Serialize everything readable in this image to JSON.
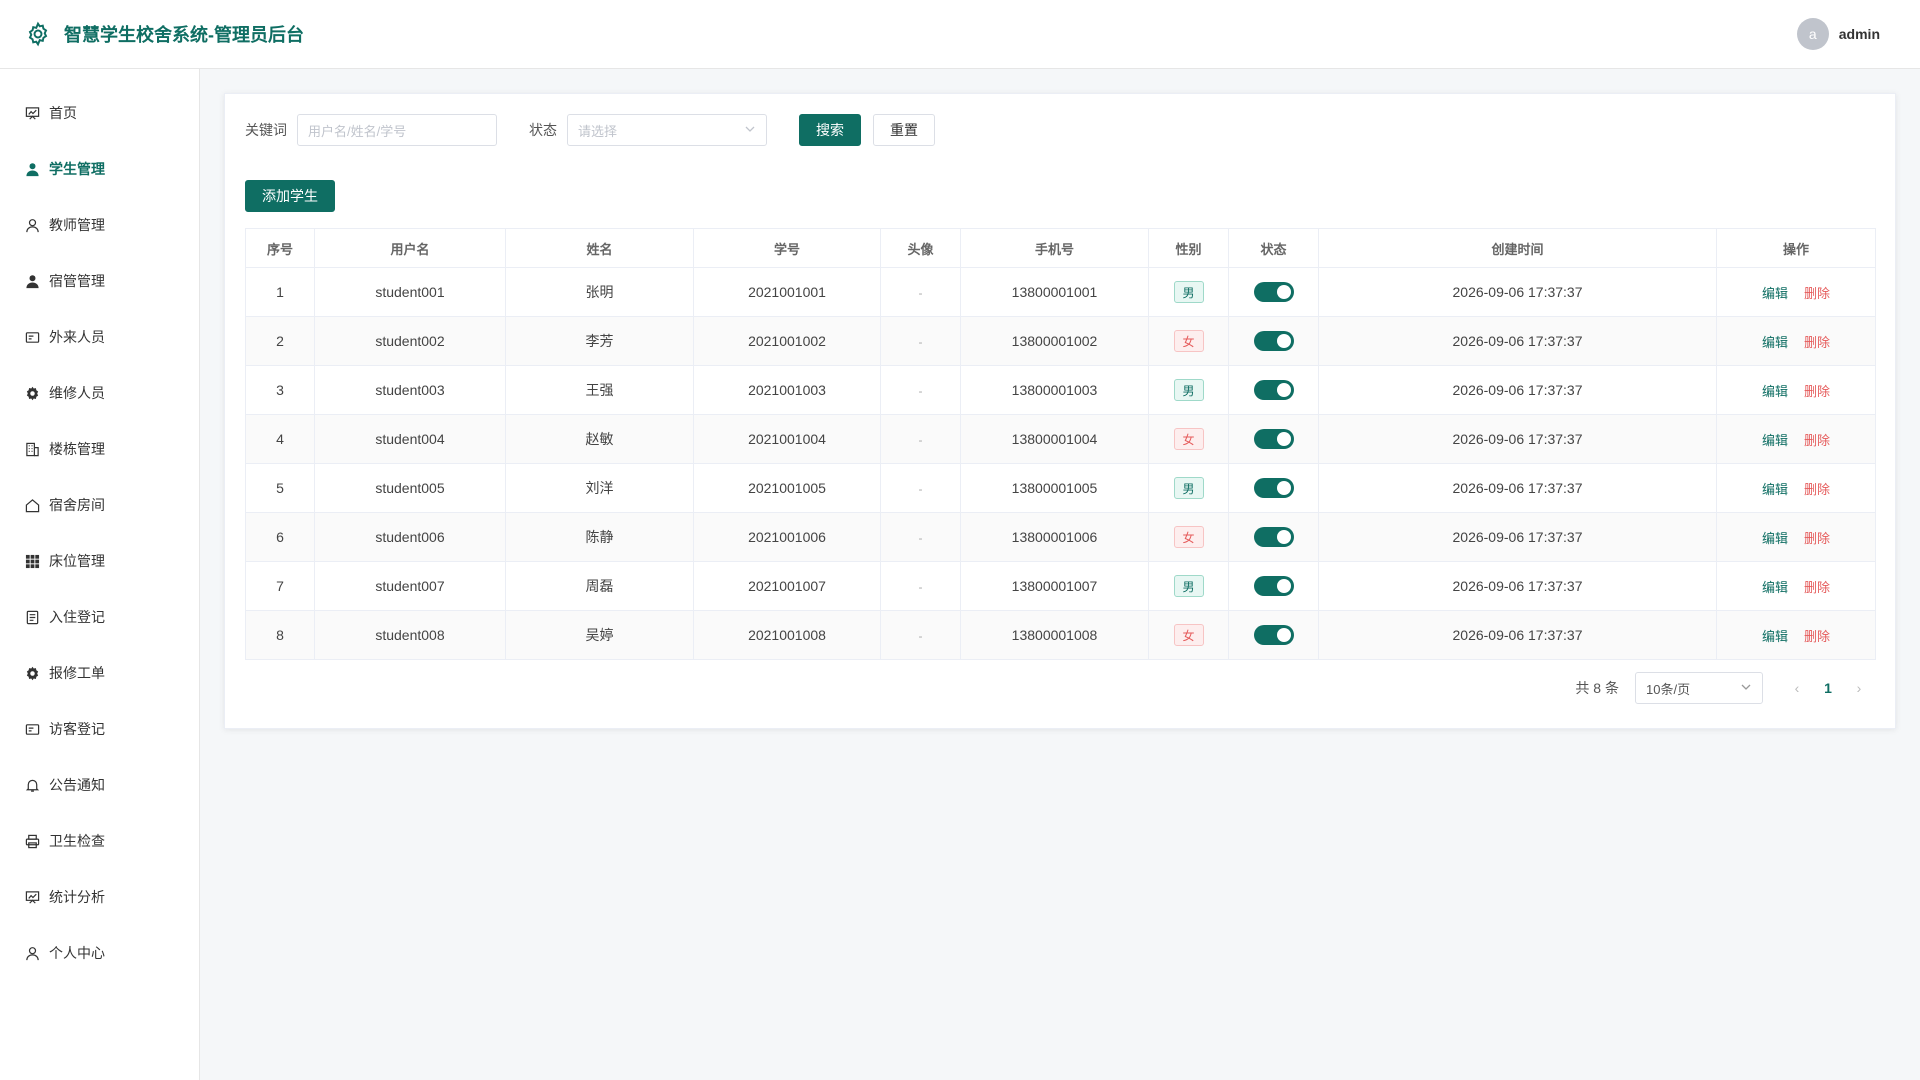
{
  "app": {
    "title": "智慧学生校舍系统-管理员后台"
  },
  "user": {
    "avatar_initial": "a",
    "name": "admin"
  },
  "sidebar": {
    "items": [
      {
        "label": "首页",
        "icon": "chart-board-icon"
      },
      {
        "label": "学生管理",
        "icon": "user-icon",
        "active": true
      },
      {
        "label": "教师管理",
        "icon": "user-outline-icon"
      },
      {
        "label": "宿管管理",
        "icon": "user-icon"
      },
      {
        "label": "外来人员",
        "icon": "id-card-icon"
      },
      {
        "label": "维修人员",
        "icon": "gear-icon"
      },
      {
        "label": "楼栋管理",
        "icon": "building-icon"
      },
      {
        "label": "宿舍房间",
        "icon": "house-icon"
      },
      {
        "label": "床位管理",
        "icon": "grid-icon"
      },
      {
        "label": "入住登记",
        "icon": "document-icon"
      },
      {
        "label": "报修工单",
        "icon": "gear-icon"
      },
      {
        "label": "访客登记",
        "icon": "id-card-icon"
      },
      {
        "label": "公告通知",
        "icon": "bell-icon"
      },
      {
        "label": "卫生检查",
        "icon": "printer-icon"
      },
      {
        "label": "统计分析",
        "icon": "chart-board-icon"
      },
      {
        "label": "个人中心",
        "icon": "user-outline-icon"
      }
    ]
  },
  "filter": {
    "keyword_label": "关键词",
    "keyword_placeholder": "用户名/姓名/学号",
    "status_label": "状态",
    "status_placeholder": "请选择",
    "search_label": "搜索",
    "reset_label": "重置"
  },
  "toolbar": {
    "add_label": "添加学生"
  },
  "table": {
    "headers": [
      "序号",
      "用户名",
      "姓名",
      "学号",
      "头像",
      "手机号",
      "性别",
      "状态",
      "创建时间",
      "操作"
    ],
    "edit_label": "编辑",
    "delete_label": "删除",
    "rows": [
      {
        "no": "1",
        "username": "student001",
        "name": "张明",
        "sid": "2021001001",
        "avatar": "-",
        "phone": "13800001001",
        "gender": "男",
        "enabled": true,
        "created": "2026-09-06 17:37:37"
      },
      {
        "no": "2",
        "username": "student002",
        "name": "李芳",
        "sid": "2021001002",
        "avatar": "-",
        "phone": "13800001002",
        "gender": "女",
        "enabled": true,
        "created": "2026-09-06 17:37:37"
      },
      {
        "no": "3",
        "username": "student003",
        "name": "王强",
        "sid": "2021001003",
        "avatar": "-",
        "phone": "13800001003",
        "gender": "男",
        "enabled": true,
        "created": "2026-09-06 17:37:37"
      },
      {
        "no": "4",
        "username": "student004",
        "name": "赵敏",
        "sid": "2021001004",
        "avatar": "-",
        "phone": "13800001004",
        "gender": "女",
        "enabled": true,
        "created": "2026-09-06 17:37:37"
      },
      {
        "no": "5",
        "username": "student005",
        "name": "刘洋",
        "sid": "2021001005",
        "avatar": "-",
        "phone": "13800001005",
        "gender": "男",
        "enabled": true,
        "created": "2026-09-06 17:37:37"
      },
      {
        "no": "6",
        "username": "student006",
        "name": "陈静",
        "sid": "2021001006",
        "avatar": "-",
        "phone": "13800001006",
        "gender": "女",
        "enabled": true,
        "created": "2026-09-06 17:37:37"
      },
      {
        "no": "7",
        "username": "student007",
        "name": "周磊",
        "sid": "2021001007",
        "avatar": "-",
        "phone": "13800001007",
        "gender": "男",
        "enabled": true,
        "created": "2026-09-06 17:37:37"
      },
      {
        "no": "8",
        "username": "student008",
        "name": "吴婷",
        "sid": "2021001008",
        "avatar": "-",
        "phone": "13800001008",
        "gender": "女",
        "enabled": true,
        "created": "2026-09-06 17:37:37"
      }
    ]
  },
  "pagination": {
    "total_text": "共 8 条",
    "page_size": "10条/页",
    "current_page": "1"
  },
  "colors": {
    "primary": "#0f6e63",
    "danger": "#e55a5a"
  }
}
